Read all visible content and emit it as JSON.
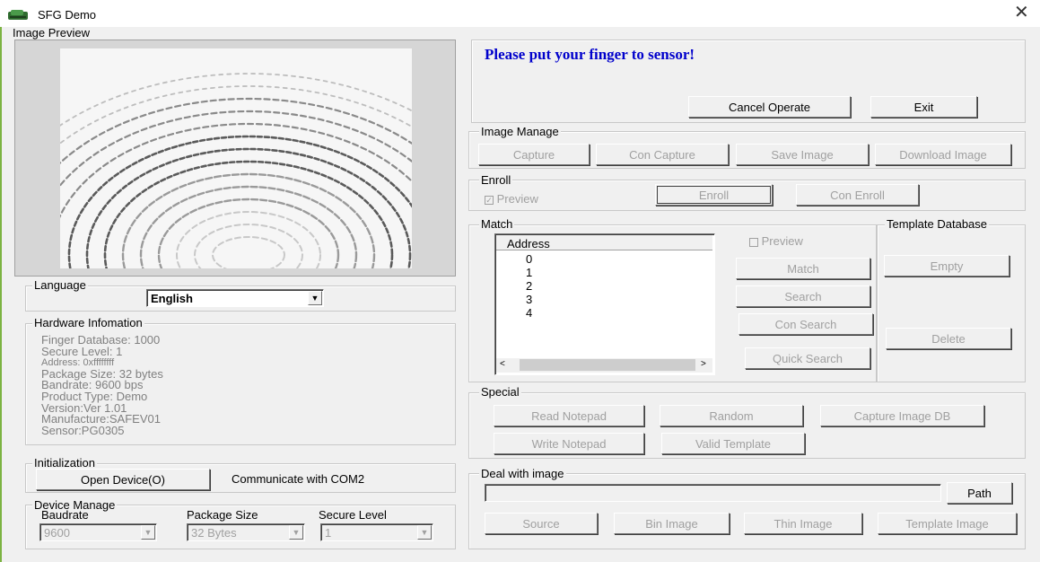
{
  "window": {
    "title": "SFG Demo",
    "close_glyph": "✕"
  },
  "image_preview": {
    "label": "Image Preview"
  },
  "status": {
    "message": "Please put your finger to sensor!",
    "message_color": "#0000cc"
  },
  "top_buttons": {
    "cancel": "Cancel Operate",
    "exit": "Exit"
  },
  "image_manage": {
    "label": "Image Manage",
    "capture": "Capture",
    "con_capture": "Con Capture",
    "save_image": "Save Image",
    "download_image": "Download Image"
  },
  "enroll": {
    "label": "Enroll",
    "preview": "Preview",
    "enroll": "Enroll",
    "con_enroll": "Con Enroll"
  },
  "match": {
    "label": "Match",
    "list_header": "Address",
    "addresses": [
      "0",
      "1",
      "2",
      "3",
      "4"
    ],
    "preview": "Preview",
    "match": "Match",
    "search": "Search",
    "con_search": "Con Search",
    "quick_search": "Quick Search"
  },
  "template_db": {
    "label": "Template Database",
    "empty": "Empty",
    "delete": "Delete"
  },
  "special": {
    "label": "Special",
    "read_notepad": "Read Notepad",
    "random": "Random",
    "capture_image_db": "Capture Image DB",
    "write_notepad": "Write Notepad",
    "valid_template": "Valid Template"
  },
  "deal": {
    "label": "Deal with image",
    "path": "Path",
    "source": "Source",
    "bin_image": "Bin Image",
    "thin_image": "Thin Image",
    "template_image": "Template Image"
  },
  "language": {
    "label": "Language",
    "value": "English"
  },
  "hardware": {
    "label": "Hardware Infomation",
    "lines": [
      "Finger Database: 1000",
      "Secure Level: 1",
      "Address: 0xffffffff",
      "Package Size: 32 bytes",
      "Bandrate: 9600 bps",
      "Product Type:  Demo",
      "Version:Ver 1.01",
      "Manufacture:SAFEV01",
      "Sensor:PG0305"
    ]
  },
  "initialization": {
    "label": "Initialization",
    "open_device": "Open Device(O)",
    "com_status": "Communicate with COM2"
  },
  "device_manage": {
    "label": "Device Manage",
    "baudrate_label": "Baudrate",
    "baudrate_value": "9600",
    "package_label": "Package Size",
    "package_value": "32 Bytes",
    "secure_label": "Secure Level",
    "secure_value": "1"
  }
}
